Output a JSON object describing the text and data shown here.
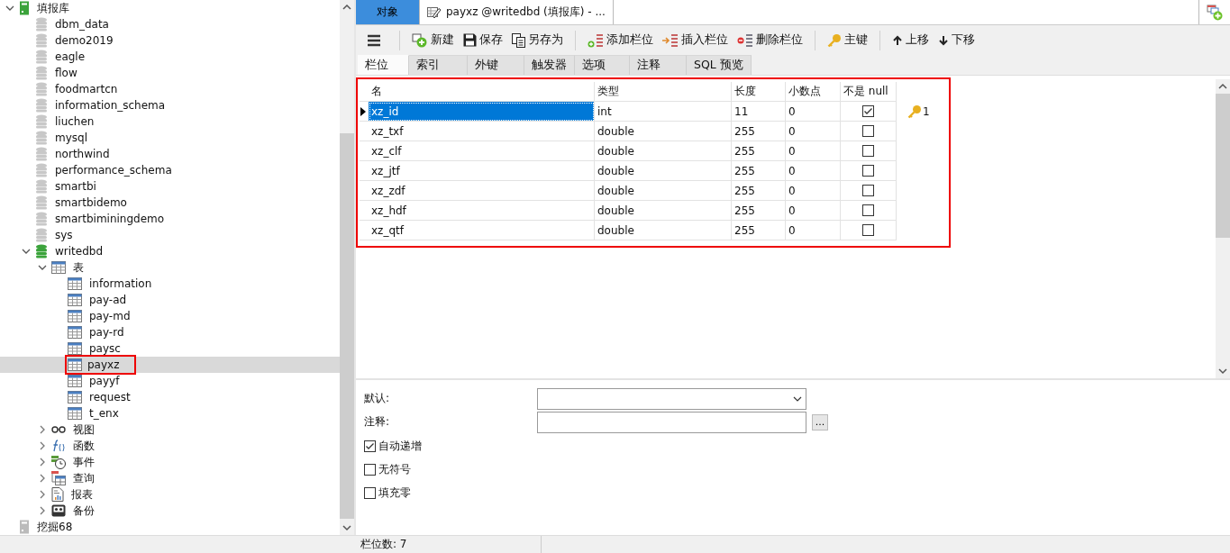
{
  "tree": [
    {
      "label": "填报库",
      "kind": "server",
      "open": true,
      "expanded": true,
      "children": [
        {
          "label": "dbm_data",
          "kind": "database",
          "open": false
        },
        {
          "label": "demo2019",
          "kind": "database",
          "open": false
        },
        {
          "label": "eagle",
          "kind": "database",
          "open": false
        },
        {
          "label": "flow",
          "kind": "database",
          "open": false
        },
        {
          "label": "foodmartcn",
          "kind": "database",
          "open": false
        },
        {
          "label": "information_schema",
          "kind": "database",
          "open": false
        },
        {
          "label": "liuchen",
          "kind": "database",
          "open": false
        },
        {
          "label": "mysql",
          "kind": "database",
          "open": false
        },
        {
          "label": "northwind",
          "kind": "database",
          "open": false
        },
        {
          "label": "performance_schema",
          "kind": "database",
          "open": false
        },
        {
          "label": "smartbi",
          "kind": "database",
          "open": false
        },
        {
          "label": "smartbidemo",
          "kind": "database",
          "open": false
        },
        {
          "label": "smartbiminingdemo",
          "kind": "database",
          "open": false
        },
        {
          "label": "sys",
          "kind": "database",
          "open": false
        },
        {
          "label": "writedbd",
          "kind": "database",
          "open": true,
          "expanded": true,
          "children": [
            {
              "label": "表",
              "kind": "tables",
              "expanded": true,
              "children": [
                {
                  "label": "information",
                  "kind": "table",
                  "selected": false
                },
                {
                  "label": "pay-ad",
                  "kind": "table",
                  "selected": false
                },
                {
                  "label": "pay-md",
                  "kind": "table",
                  "selected": false
                },
                {
                  "label": "pay-rd",
                  "kind": "table",
                  "selected": false
                },
                {
                  "label": "paysc",
                  "kind": "table",
                  "selected": false
                },
                {
                  "label": "payxz",
                  "kind": "table",
                  "selected": true
                },
                {
                  "label": "payyf",
                  "kind": "table",
                  "selected": false
                },
                {
                  "label": "request",
                  "kind": "table",
                  "selected": false
                },
                {
                  "label": "t_enx",
                  "kind": "table",
                  "selected": false
                }
              ]
            },
            {
              "label": "视图",
              "kind": "views",
              "expanded": false
            },
            {
              "label": "函数",
              "kind": "functions",
              "expanded": false
            },
            {
              "label": "事件",
              "kind": "events",
              "expanded": false
            },
            {
              "label": "查询",
              "kind": "queries",
              "expanded": false
            },
            {
              "label": "报表",
              "kind": "reports",
              "expanded": false
            },
            {
              "label": "备份",
              "kind": "backups",
              "expanded": false
            }
          ]
        }
      ]
    },
    {
      "label": "挖掘68",
      "kind": "server",
      "open": false
    }
  ],
  "tabs": [
    {
      "label": "对象",
      "kind": "objects",
      "selected": false
    },
    {
      "label": "payxz @writedbd (填报库) - ...",
      "kind": "design",
      "selected": true
    }
  ],
  "toolbar": [
    {
      "label": "新建",
      "kind": "new"
    },
    {
      "label": "保存",
      "kind": "save"
    },
    {
      "label": "另存为",
      "kind": "saveas"
    },
    {
      "label": "添加栏位",
      "kind": "add"
    },
    {
      "label": "插入栏位",
      "kind": "insert"
    },
    {
      "label": "删除栏位",
      "kind": "delete"
    },
    {
      "label": "主键",
      "kind": "key"
    },
    {
      "label": "上移",
      "kind": "up"
    },
    {
      "label": "下移",
      "kind": "down"
    }
  ],
  "subtabs": [
    {
      "label": "栏位",
      "selected": true
    },
    {
      "label": "索引",
      "selected": false
    },
    {
      "label": "外键",
      "selected": false
    },
    {
      "label": "触发器",
      "selected": false
    },
    {
      "label": "选项",
      "selected": false
    },
    {
      "label": "注释",
      "selected": false
    },
    {
      "label": "SQL 预览",
      "selected": false
    }
  ],
  "fields": {
    "columns": [
      "名",
      "类型",
      "长度",
      "小数点",
      "不是 null"
    ],
    "rows": [
      {
        "name": "xz_id",
        "type": "int",
        "length": "11",
        "decimals": "0",
        "not_null": true,
        "key": "1",
        "selected": true
      },
      {
        "name": "xz_txf",
        "type": "double",
        "length": "255",
        "decimals": "0",
        "not_null": false,
        "selected": false
      },
      {
        "name": "xz_clf",
        "type": "double",
        "length": "255",
        "decimals": "0",
        "not_null": false,
        "selected": false
      },
      {
        "name": "xz_jtf",
        "type": "double",
        "length": "255",
        "decimals": "0",
        "not_null": false,
        "selected": false
      },
      {
        "name": "xz_zdf",
        "type": "double",
        "length": "255",
        "decimals": "0",
        "not_null": false,
        "selected": false
      },
      {
        "name": "xz_hdf",
        "type": "double",
        "length": "255",
        "decimals": "0",
        "not_null": false,
        "selected": false
      },
      {
        "name": "xz_qtf",
        "type": "double",
        "length": "255",
        "decimals": "0",
        "not_null": false,
        "selected": false
      }
    ]
  },
  "properties": {
    "default_label": "默认:",
    "comment_label": "注释:",
    "comment_button": "...",
    "options": [
      {
        "label": "自动递增",
        "checked": true
      },
      {
        "label": "无符号",
        "checked": false
      },
      {
        "label": "填充零",
        "checked": false
      }
    ]
  },
  "status_bar": {
    "text": "栏位数: 7"
  }
}
